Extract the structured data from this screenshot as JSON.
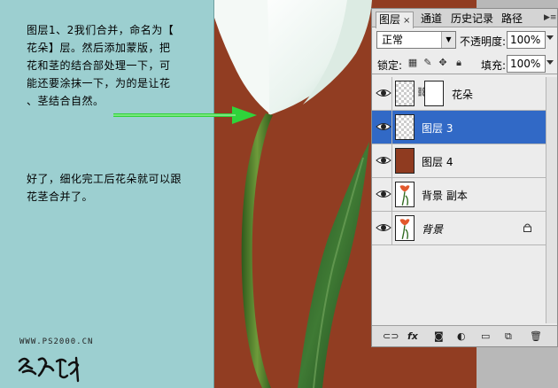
{
  "tutorial": {
    "paragraph1": "图层1、2我们合并，命名为【\n花朵】层。然后添加蒙版，把\n花和茎的结合部处理一下，可\n能还要涂抹一下，为的是让花\n、茎结合自然。",
    "paragraph2": "好了，细化完工后花朵就可以跟\n花茎合并了。",
    "site": "WWW.PS2000.CN"
  },
  "colors": {
    "background_left": "#9ccfd0",
    "photo_background": "#913d22",
    "arrow": "#2fd43a",
    "selection": "#3169c6"
  },
  "panel": {
    "tabs": [
      {
        "label": "图层",
        "active": true,
        "close": "×"
      },
      {
        "label": "通道"
      },
      {
        "label": "历史记录"
      },
      {
        "label": "路径"
      }
    ],
    "menu_icon": "panel-menu-icon",
    "blend_mode": "正常",
    "opacity_label": "不透明度:",
    "opacity_value": "100%",
    "lock_label": "锁定:",
    "fill_label": "填充:",
    "fill_value": "100%",
    "layers": [
      {
        "name": "花朵",
        "thumb": "checker",
        "has_mask": true,
        "selected": false
      },
      {
        "name": "图层 3",
        "thumb": "checker",
        "has_mask": false,
        "selected": true
      },
      {
        "name": "图层 4",
        "thumb": "brown",
        "has_mask": false,
        "selected": false
      },
      {
        "name": "背景 副本",
        "thumb": "tulip",
        "has_mask": false,
        "selected": false
      },
      {
        "name": "背景",
        "thumb": "tulip",
        "has_mask": false,
        "selected": false,
        "locked": true
      }
    ],
    "bottom_icons": [
      "link-icon",
      "fx-icon",
      "add-mask-icon",
      "adjustment-icon",
      "new-group-icon",
      "new-layer-icon",
      "delete-icon"
    ],
    "fx_label": "fx"
  }
}
